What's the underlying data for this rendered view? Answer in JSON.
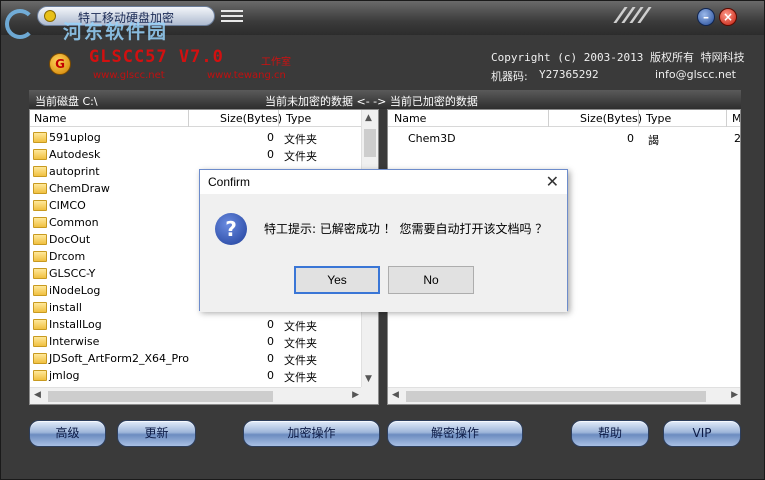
{
  "window": {
    "title": "特工移动硬盘加密"
  },
  "header": {
    "brand": "GLSCC57 V7.0",
    "tagline": "工作室",
    "url1": "www.glscc.net",
    "url2": "www.tewang.cn",
    "copyright": "Copyright (c) 2003-2013 版权所有 特网科技",
    "machine_label": "机器码:",
    "machine_code": "Y27365292",
    "email": "info@glscc.net"
  },
  "watermark": {
    "text": "河东软件园"
  },
  "pathbar": {
    "current_disk": "当前磁盘 C:\\",
    "direction": "当前未加密的数据 <- -> 当前已加密的数据"
  },
  "left_panel": {
    "columns": [
      "Name",
      "Size(Bytes)",
      "Type"
    ],
    "rows": [
      {
        "name": "591uplog",
        "size": "0",
        "type": "文件夹"
      },
      {
        "name": "Autodesk",
        "size": "0",
        "type": "文件夹"
      },
      {
        "name": "autoprint",
        "size": "",
        "type": ""
      },
      {
        "name": "ChemDraw",
        "size": "",
        "type": ""
      },
      {
        "name": "CIMCO",
        "size": "",
        "type": ""
      },
      {
        "name": "Common",
        "size": "",
        "type": ""
      },
      {
        "name": "DocOut",
        "size": "",
        "type": ""
      },
      {
        "name": "Drcom",
        "size": "",
        "type": ""
      },
      {
        "name": "GLSCC-Y",
        "size": "",
        "type": ""
      },
      {
        "name": "iNodeLog",
        "size": "",
        "type": ""
      },
      {
        "name": "install",
        "size": "",
        "type": ""
      },
      {
        "name": "InstallLog",
        "size": "0",
        "type": "文件夹"
      },
      {
        "name": "Interwise",
        "size": "0",
        "type": "文件夹"
      },
      {
        "name": "JDSoft_ArtForm2_X64_Pro",
        "size": "0",
        "type": "文件夹"
      },
      {
        "name": "jmlog",
        "size": "0",
        "type": "文件夹"
      }
    ]
  },
  "right_panel": {
    "columns": [
      "Name",
      "Size(Bytes)",
      "Type",
      "M"
    ],
    "rows": [
      {
        "name": "Chem3D",
        "size": "0",
        "type": "謁",
        "extra": "2"
      }
    ]
  },
  "buttons": {
    "advanced": "高级",
    "refresh": "更新",
    "encrypt": "加密操作",
    "decrypt": "解密操作",
    "help": "帮助",
    "vip": "VIP"
  },
  "dialog": {
    "title": "Confirm",
    "message": "特工提示: 已解密成功 ！ 您需要自动打开该文档吗 ？",
    "yes": "Yes",
    "no": "No"
  }
}
